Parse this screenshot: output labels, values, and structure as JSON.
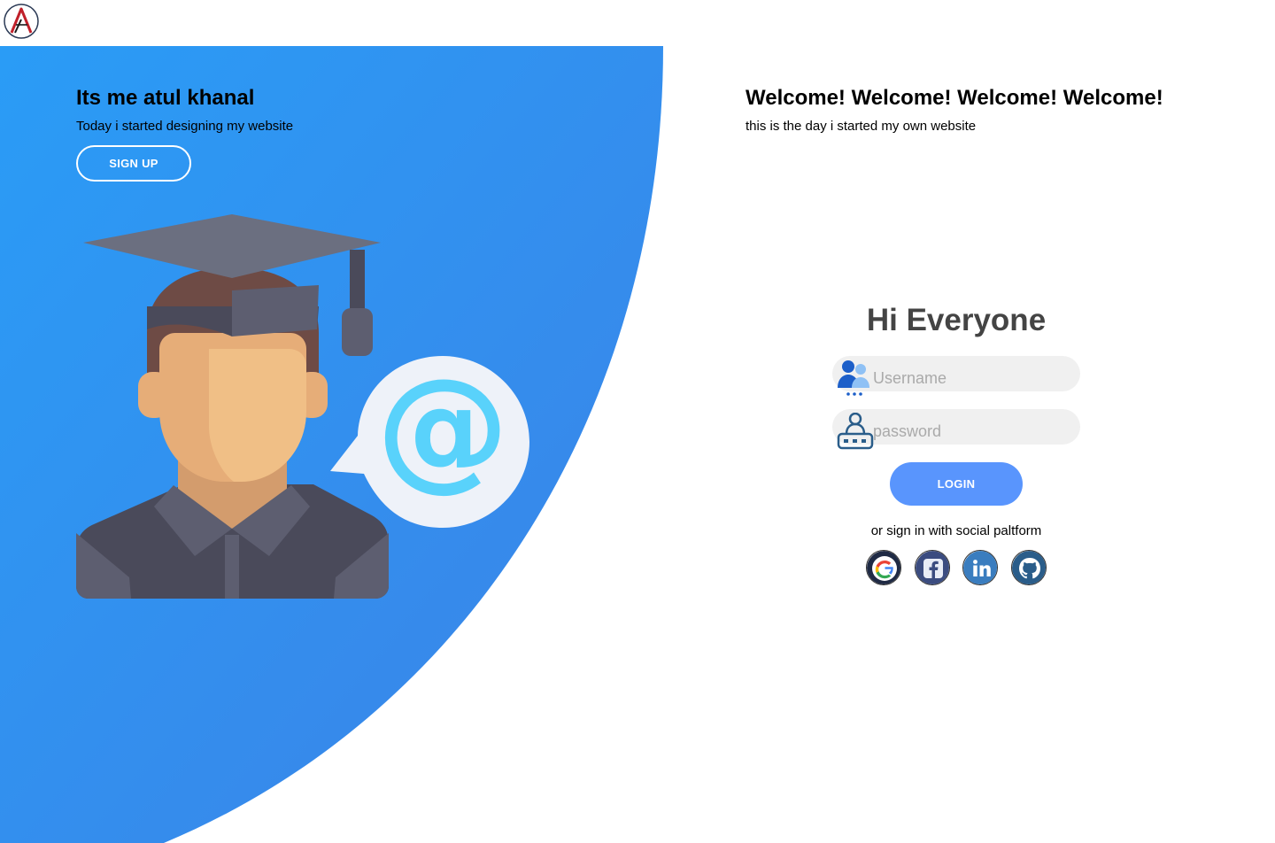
{
  "header": {
    "logo_icon": "atul-logo-icon"
  },
  "left_panel": {
    "title": "Its me atul khanal",
    "subtitle": "Today i started designing my website",
    "signup_label": "SIGN UP",
    "illustration_icon": "graduate-email-illustration",
    "gradient_colors": [
      "#2a9cf6",
      "#3c82e6"
    ]
  },
  "right_panel": {
    "title": "Welcome! Welcome! Welcome! Welcome!",
    "subtitle": "this is the day i started my own website"
  },
  "login_form": {
    "title": "Hi Everyone",
    "username": {
      "value": "",
      "placeholder": "Username",
      "icon": "users-icon"
    },
    "password": {
      "value": "",
      "placeholder": "password",
      "icon": "user-password-icon"
    },
    "login_label": "LOGIN",
    "social_text": "or sign in with social paltform",
    "social": [
      {
        "icon": "google-icon"
      },
      {
        "icon": "facebook-icon"
      },
      {
        "icon": "linkedin-icon"
      },
      {
        "icon": "github-icon"
      }
    ]
  },
  "colors": {
    "accent": "#5995fd",
    "field_bg": "#f0f0f0",
    "title_text": "#444444"
  }
}
